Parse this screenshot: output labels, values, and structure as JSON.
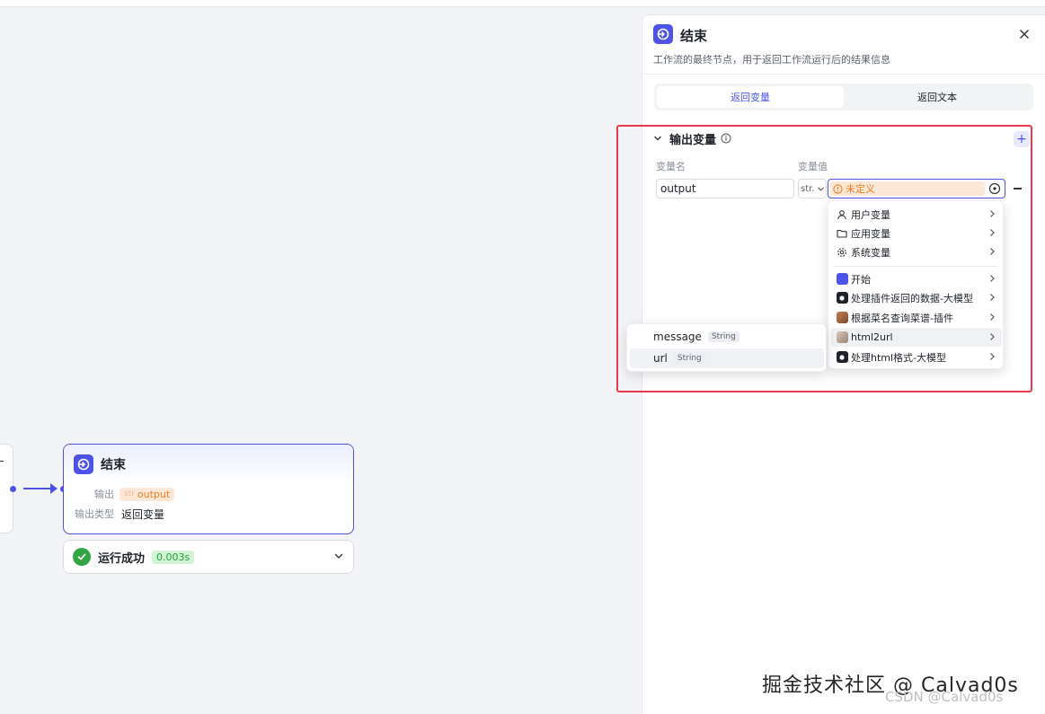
{
  "canvas": {
    "end_node": {
      "title": "结束",
      "output_label": "输出",
      "output_tag_type": "str",
      "output_value": "output",
      "output_type_label": "输出类型",
      "output_type_value": "返回变量"
    },
    "run_status": {
      "label": "运行成功",
      "time": "0.003s"
    }
  },
  "panel": {
    "title": "结束",
    "description": "工作流的最终节点，用于返回工作流运行后的结果信息",
    "tabs": [
      {
        "label": "返回变量",
        "active": true
      },
      {
        "label": "返回文本",
        "active": false
      }
    ],
    "section_title": "输出变量",
    "add_label": "+",
    "col_name": "变量名",
    "col_value": "变量值",
    "row": {
      "name": "output",
      "type": "str.",
      "value_placeholder": "未定义"
    },
    "menu": {
      "items": [
        {
          "label": "用户变量",
          "icon": "user-icon"
        },
        {
          "label": "应用变量",
          "icon": "folder-icon"
        },
        {
          "label": "系统变量",
          "icon": "gear-icon"
        },
        {
          "label": "开始",
          "icon": "start-node-icon"
        },
        {
          "label": "处理插件返回的数据-大模型",
          "icon": "llm-bot-icon"
        },
        {
          "label": "根据菜名查询菜谱-插件",
          "icon": "plugin-photo-icon"
        },
        {
          "label": "html2url",
          "icon": "plugin-avatar-icon"
        },
        {
          "label": "处理html格式-大模型",
          "icon": "llm-bot-icon"
        }
      ],
      "highlighted_index": 6
    },
    "submenu": {
      "items": [
        {
          "label": "message",
          "type": "String"
        },
        {
          "label": "url",
          "type": "String"
        }
      ],
      "highlighted_index": 1
    }
  },
  "watermark": {
    "main": "掘金技术社区 @ Calvad0s",
    "sub": "CSDN @Calvad0s"
  },
  "colors": {
    "accent": "#4d53e8",
    "highlight_box": "#e8394f",
    "warning_orange": "#f07c1f",
    "success_green": "#32a645"
  }
}
